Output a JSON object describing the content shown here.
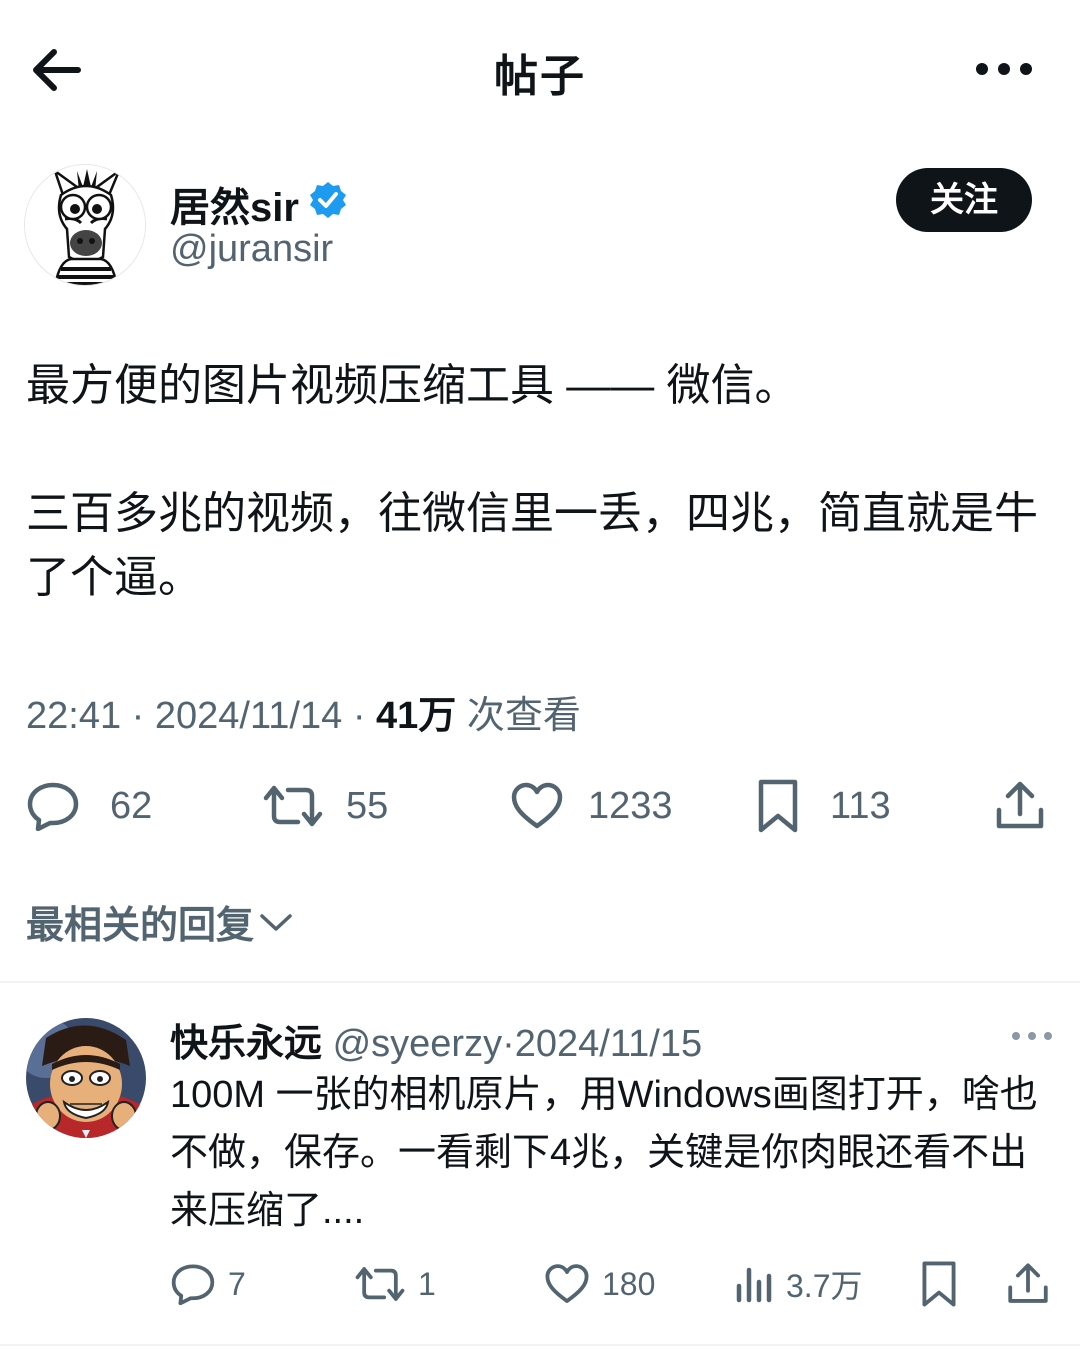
{
  "header": {
    "title": "帖子"
  },
  "author": {
    "name": "居然sir",
    "handle": "@juransir",
    "follow_label": "关注"
  },
  "post": {
    "line1": "最方便的图片视频压缩工具 —— 微信。",
    "line2": "三百多兆的视频，往微信里一丢，四兆，简直就是牛了个逼。",
    "time": "22:41",
    "date": "2024/11/14",
    "views_count": "41万",
    "views_label": "次查看",
    "separator": "·"
  },
  "stats": {
    "replies": "62",
    "reposts": "55",
    "likes": "1233",
    "bookmarks": "113"
  },
  "replies_section": {
    "sort_label": "最相关的回复"
  },
  "reply": {
    "name": "快乐永远",
    "handle": "@syeerzy",
    "date": "2024/11/15",
    "separator": "·",
    "text": "100M 一张的相机原片，用Windows画图打开，啥也不做，保存。一看剩下4兆，关键是你肉眼还看不出来压缩了....",
    "replies": "7",
    "reposts": "1",
    "likes": "180",
    "views": "3.7万"
  },
  "colors": {
    "text_primary": "#0f1419",
    "text_secondary": "#536471",
    "verified_blue": "#1d9bf0",
    "divider": "#eff3f4"
  },
  "icons": [
    "back-arrow-icon",
    "more-icon",
    "verified-icon",
    "reply-icon",
    "repost-icon",
    "like-icon",
    "bookmark-icon",
    "share-icon",
    "views-icon",
    "chevron-down-icon"
  ]
}
